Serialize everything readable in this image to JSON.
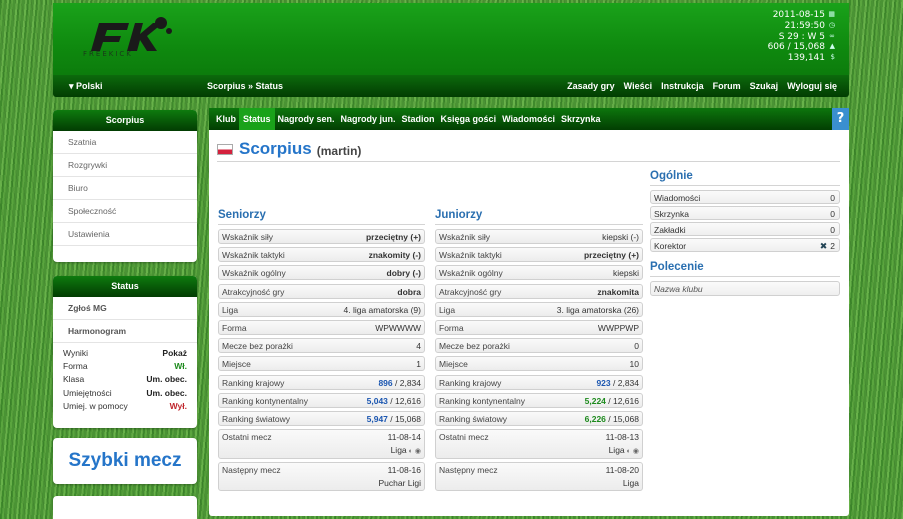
{
  "header": {
    "logo_text": "FREEKICK",
    "stats": [
      "2011-08-15",
      "21:59:50",
      "S 29 : W 5",
      "606 / 15,068",
      "139,141"
    ],
    "stat_icons": [
      "calendar-icon",
      "clock-icon",
      "infinity-icon",
      "up-arrow-icon",
      "money-icon"
    ]
  },
  "nav": {
    "language": "Polski",
    "breadcrumb": "Scorpius » Status",
    "links": [
      "Zasady gry",
      "Wieści",
      "Instrukcja",
      "Forum",
      "Szukaj",
      "Wyloguj się"
    ]
  },
  "sidebar": {
    "club_title": "Scorpius",
    "menu": [
      "Szatnia",
      "Rozgrywki",
      "Biuro",
      "Społeczność",
      "Ustawienia"
    ],
    "status_title": "Status",
    "status_links": [
      "Zgłoś MG",
      "Harmonogram"
    ],
    "status_rows": [
      {
        "label": "Wyniki",
        "value": "Pokaż",
        "color": "#222222"
      },
      {
        "label": "Forma",
        "value": "Wł.",
        "color": "#1d8a1d"
      },
      {
        "label": "Klasa",
        "value": "Um. obec.",
        "color": "#222222"
      },
      {
        "label": "Umiejętności",
        "value": "Um. obec.",
        "color": "#222222"
      },
      {
        "label": "Umiej. w pomocy",
        "value": "Wył.",
        "color": "#c0262c"
      }
    ],
    "quick_match": "Szybki mecz"
  },
  "tabs": [
    "Klub",
    "Status",
    "Nagrody sen.",
    "Nagrody jun.",
    "Stadion",
    "Księga gości",
    "Wiadomości",
    "Skrzynka"
  ],
  "active_tab": "Status",
  "help_label": "?",
  "club": {
    "name": "Scorpius",
    "owner": "(martin)"
  },
  "seniors": {
    "title": "Seniorzy",
    "rows": [
      {
        "label": "Wskaźnik siły",
        "value": "przeciętny (+)",
        "cls": "b gray"
      },
      {
        "label": "Wskaźnik taktyki",
        "value": "znakomity (-)",
        "cls": "b blue"
      },
      {
        "label": "Wskaźnik ogólny",
        "value": "dobry (-)",
        "cls": "b green"
      },
      {
        "label": "Atrakcyjność gry",
        "value": "dobra",
        "cls": "b green"
      },
      {
        "label": "Liga",
        "value": "4. liga amatorska (9)",
        "cls": ""
      },
      {
        "label": "Forma",
        "value": "WPWWWW",
        "cls": "gray"
      },
      {
        "label": "Mecze bez porażki",
        "value": "4",
        "cls": ""
      },
      {
        "label": "Miejsce",
        "value": "1",
        "cls": ""
      },
      {
        "label": "Ranking krajowy",
        "value_main": "896",
        "value_rest": " / 2,834",
        "main_cls": "b blue"
      },
      {
        "label": "Ranking kontynentalny",
        "value_main": "5,043",
        "value_rest": " / 12,616",
        "main_cls": "b blue"
      },
      {
        "label": "Ranking światowy",
        "value_main": "5,947",
        "value_rest": " / 15,068",
        "main_cls": "b blue"
      }
    ],
    "last_match": {
      "label": "Ostatni mecz",
      "date": "11-08-14",
      "comp": "Liga"
    },
    "next_match": {
      "label": "Następny mecz",
      "date": "11-08-16",
      "comp": "Puchar Ligi"
    }
  },
  "juniors": {
    "title": "Juniorzy",
    "rows": [
      {
        "label": "Wskaźnik siły",
        "value": "kiepski (-)",
        "cls": "orange"
      },
      {
        "label": "Wskaźnik taktyki",
        "value": "przeciętny (+)",
        "cls": "b gray"
      },
      {
        "label": "Wskaźnik ogólny",
        "value": "kiepski",
        "cls": "orange"
      },
      {
        "label": "Atrakcyjność gry",
        "value": "znakomita",
        "cls": "b blue"
      },
      {
        "label": "Liga",
        "value": "3. liga amatorska (26)",
        "cls": ""
      },
      {
        "label": "Forma",
        "value": "WWPPWP",
        "cls": "gray"
      },
      {
        "label": "Mecze bez porażki",
        "value": "0",
        "cls": ""
      },
      {
        "label": "Miejsce",
        "value": "10",
        "cls": ""
      },
      {
        "label": "Ranking krajowy",
        "value_main": "923",
        "value_rest": " / 2,834",
        "main_cls": "b blue"
      },
      {
        "label": "Ranking kontynentalny",
        "value_main": "5,224",
        "value_rest": " / 12,616",
        "main_cls": "b green"
      },
      {
        "label": "Ranking światowy",
        "value_main": "6,226",
        "value_rest": " / 15,068",
        "main_cls": "b green"
      }
    ],
    "last_match": {
      "label": "Ostatni mecz",
      "date": "11-08-13",
      "comp": "Liga"
    },
    "next_match": {
      "label": "Następny mecz",
      "date": "11-08-20",
      "comp": "Liga"
    }
  },
  "general": {
    "title": "Ogólnie",
    "rows": [
      {
        "label": "Wiadomości",
        "value": "0"
      },
      {
        "label": "Skrzynka",
        "value": "0"
      },
      {
        "label": "Zakładki",
        "value": "0"
      },
      {
        "label": "Korektor",
        "value": "2"
      }
    ]
  },
  "recommendation": {
    "title": "Polecenie",
    "placeholder": "Nazwa klubu"
  }
}
